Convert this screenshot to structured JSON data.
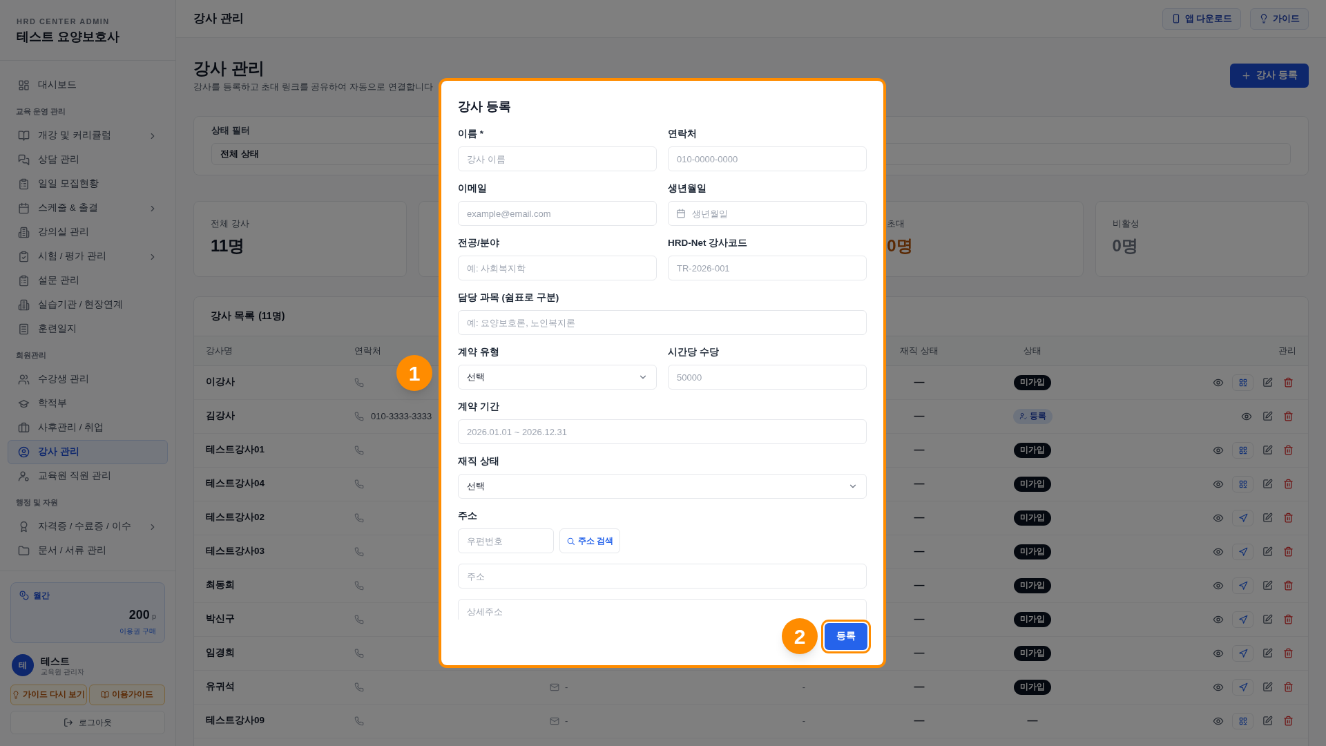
{
  "sidebar": {
    "eyebrow": "HRD CENTER ADMIN",
    "title": "테스트 요양보호사",
    "nav": [
      {
        "kind": "item",
        "label": "대시보드",
        "selected": false,
        "expandable": false
      },
      {
        "kind": "section",
        "label": "교육 운영 관리"
      },
      {
        "kind": "item",
        "label": "개강 및 커리큘럼",
        "selected": false,
        "expandable": true
      },
      {
        "kind": "item",
        "label": "상담 관리",
        "selected": false,
        "expandable": false
      },
      {
        "kind": "item",
        "label": "일일 모집현황",
        "selected": false,
        "expandable": false
      },
      {
        "kind": "item",
        "label": "스케줄 & 출결",
        "selected": false,
        "expandable": true
      },
      {
        "kind": "item",
        "label": "강의실 관리",
        "selected": false,
        "expandable": false
      },
      {
        "kind": "item",
        "label": "시험 / 평가 관리",
        "selected": false,
        "expandable": true
      },
      {
        "kind": "item",
        "label": "설문 관리",
        "selected": false,
        "expandable": false
      },
      {
        "kind": "item",
        "label": "실습기관 / 현장연계",
        "selected": false,
        "expandable": false
      },
      {
        "kind": "item",
        "label": "훈련일지",
        "selected": false,
        "expandable": false
      },
      {
        "kind": "section",
        "label": "회원관리"
      },
      {
        "kind": "item",
        "label": "수강생 관리",
        "selected": false,
        "expandable": false
      },
      {
        "kind": "item",
        "label": "학적부",
        "selected": false,
        "expandable": false
      },
      {
        "kind": "item",
        "label": "사후관리 / 취업",
        "selected": false,
        "expandable": false
      },
      {
        "kind": "item",
        "label": "강사 관리",
        "selected": true,
        "expandable": false
      },
      {
        "kind": "item",
        "label": "교육원 직원 관리",
        "selected": false,
        "expandable": false
      },
      {
        "kind": "section",
        "label": "행정 및 자원"
      },
      {
        "kind": "item",
        "label": "자격증 / 수료증 / 이수",
        "selected": false,
        "expandable": true
      },
      {
        "kind": "item",
        "label": "문서 / 서류 관리",
        "selected": false,
        "expandable": false
      }
    ],
    "plan": {
      "label": "월간",
      "amount": "200",
      "unit": "p",
      "link": "이용권 구매"
    },
    "user": {
      "avatar": "테",
      "name": "테스트",
      "role": "교육원 관리자"
    },
    "guide_buttons": [
      "가이드 다시 보기",
      "이용가이드"
    ],
    "logout": "로그아웃"
  },
  "header": {
    "title": "강사 관리",
    "buttons": [
      "앱 다운로드",
      "가이드"
    ]
  },
  "page": {
    "title": "강사 관리",
    "subtitle": "강사를 등록하고 초대 링크를 공유하여 자동으로 연결합니다",
    "add_button": "강사 등록"
  },
  "filter": {
    "label": "상태 필터",
    "value": "전체 상태"
  },
  "stats": [
    {
      "kind": "total",
      "label": "전체 강사",
      "value": "11명"
    },
    {
      "kind": "covered"
    },
    {
      "kind": "invited",
      "label": "초대",
      "value": "0명"
    },
    {
      "kind": "inactive",
      "label": "비활성",
      "value": "0명"
    }
  ],
  "table": {
    "title": "강사 목록",
    "count": "(11명)",
    "columns": [
      "강사명",
      "연락처",
      "재직 상태",
      "상태",
      "관리"
    ],
    "rows": [
      {
        "name": "이강사",
        "employment": "—",
        "status": {
          "kind": "unregistered",
          "label": "미가입"
        },
        "actions": [
          {
            "kind": "view"
          },
          {
            "kind": "qr"
          },
          {
            "kind": "edit"
          },
          {
            "kind": "delete"
          }
        ]
      },
      {
        "name": "김강사",
        "phone": "010-3333-3333",
        "employment": "—",
        "status": {
          "kind": "registered",
          "label": "등록"
        },
        "actions": [
          {
            "kind": "view"
          },
          {
            "kind": "edit"
          },
          {
            "kind": "delete"
          }
        ]
      },
      {
        "name": "테스트강사01",
        "employment": "—",
        "status": {
          "kind": "unregistered",
          "label": "미가입"
        },
        "actions": [
          {
            "kind": "view"
          },
          {
            "kind": "qr"
          },
          {
            "kind": "edit"
          },
          {
            "kind": "delete"
          }
        ]
      },
      {
        "name": "테스트강사04",
        "employment": "—",
        "status": {
          "kind": "unregistered",
          "label": "미가입"
        },
        "actions": [
          {
            "kind": "view"
          },
          {
            "kind": "qr"
          },
          {
            "kind": "edit"
          },
          {
            "kind": "delete"
          }
        ]
      },
      {
        "name": "테스트강사02",
        "employment": "—",
        "status": {
          "kind": "unregistered",
          "label": "미가입"
        },
        "actions": [
          {
            "kind": "view"
          },
          {
            "kind": "send"
          },
          {
            "kind": "edit"
          },
          {
            "kind": "delete"
          }
        ]
      },
      {
        "name": "테스트강사03",
        "employment": "—",
        "status": {
          "kind": "unregistered",
          "label": "미가입"
        },
        "actions": [
          {
            "kind": "view"
          },
          {
            "kind": "send"
          },
          {
            "kind": "edit"
          },
          {
            "kind": "delete"
          }
        ]
      },
      {
        "name": "최동희",
        "employment": "—",
        "status": {
          "kind": "unregistered",
          "label": "미가입"
        },
        "actions": [
          {
            "kind": "view"
          },
          {
            "kind": "send"
          },
          {
            "kind": "edit"
          },
          {
            "kind": "delete"
          }
        ]
      },
      {
        "name": "박신구",
        "employment": "—",
        "status": {
          "kind": "unregistered",
          "label": "미가입"
        },
        "actions": [
          {
            "kind": "view"
          },
          {
            "kind": "send"
          },
          {
            "kind": "edit"
          },
          {
            "kind": "delete"
          }
        ]
      },
      {
        "name": "임경희",
        "employment": "—",
        "status": {
          "kind": "unregistered",
          "label": "미가입"
        },
        "actions": [
          {
            "kind": "view"
          },
          {
            "kind": "send"
          },
          {
            "kind": "edit"
          },
          {
            "kind": "delete"
          }
        ]
      },
      {
        "name": "유귀석",
        "email": "-",
        "column_4": "-",
        "employment": "—",
        "status": {
          "kind": "unregistered",
          "label": "미가입"
        },
        "actions": [
          {
            "kind": "view"
          },
          {
            "kind": "send"
          },
          {
            "kind": "edit"
          },
          {
            "kind": "delete"
          }
        ]
      },
      {
        "name": "테스트강사09",
        "email": "-",
        "column_4": "-",
        "employment": "—",
        "status": {
          "kind": "dash",
          "label": "—"
        },
        "actions": [
          {
            "kind": "view"
          },
          {
            "kind": "qr"
          },
          {
            "kind": "edit"
          },
          {
            "kind": "delete"
          }
        ]
      }
    ]
  },
  "modal": {
    "title": "강사 등록",
    "fields": [
      {
        "kind": "input",
        "label": "이름 *",
        "placeholder": "강사 이름",
        "wide": false
      },
      {
        "kind": "input",
        "label": "연락처",
        "placeholder": "010-0000-0000",
        "wide": false
      },
      {
        "kind": "input",
        "label": "이메일",
        "placeholder": "example@email.com",
        "wide": false
      },
      {
        "kind": "date",
        "label": "생년월일",
        "placeholder": "생년월일",
        "wide": false
      },
      {
        "kind": "input",
        "label": "전공/분야",
        "placeholder": "예: 사회복지학",
        "wide": false
      },
      {
        "kind": "input",
        "label": "HRD-Net 강사코드",
        "placeholder": "TR-2026-001",
        "wide": false
      },
      {
        "kind": "input",
        "label": "담당 과목 (쉼표로 구분)",
        "placeholder": "예: 요양보호론, 노인복지론",
        "wide": true
      },
      {
        "kind": "select",
        "label": "계약 유형",
        "value": "선택",
        "wide": false
      },
      {
        "kind": "input",
        "label": "시간당 수당",
        "placeholder": "50000",
        "wide": false
      },
      {
        "kind": "input",
        "label": "계약 기간",
        "placeholder": "2026.01.01 ~ 2026.12.31",
        "wide": true
      },
      {
        "kind": "select",
        "label": "재직 상태",
        "value": "선택",
        "wide": true
      },
      {
        "kind": "address",
        "label": "주소",
        "zip_placeholder": "우편번호",
        "search_button": "주소 검색",
        "address_placeholder": "주소",
        "detail_placeholder": "상세주소",
        "wide": true
      }
    ],
    "submit": "등록"
  },
  "annotations": [
    {
      "label": "1"
    },
    {
      "label": "2"
    }
  ]
}
